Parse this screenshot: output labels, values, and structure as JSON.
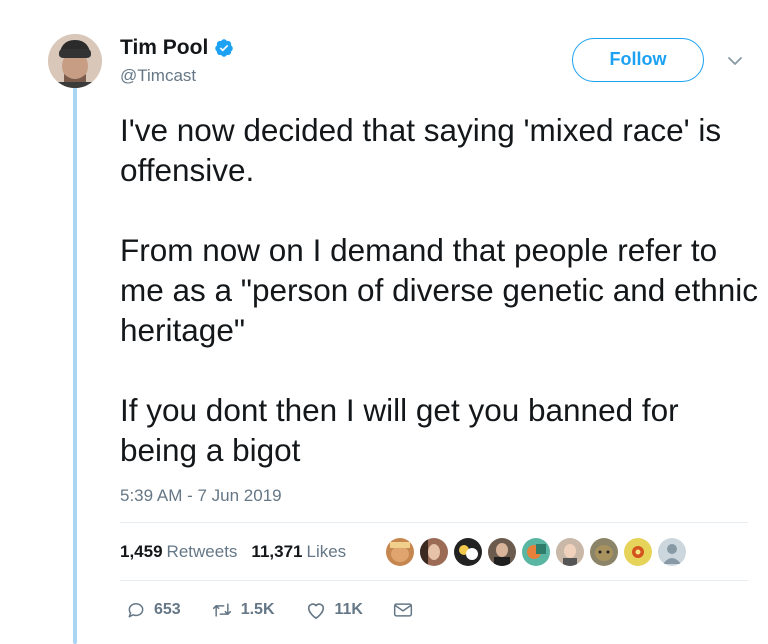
{
  "user": {
    "name": "Tim Pool",
    "handle": "@Timcast"
  },
  "follow_button": {
    "label": "Follow"
  },
  "tweet": {
    "paragraphs": [
      "I've now decided that saying 'mixed race' is offensive.",
      "From now on I demand that people refer to me as a \"person of diverse genetic and ethnic heritage\"",
      "If you dont then I will get you banned for being a bigot"
    ],
    "timestamp": "5:39 AM - 7 Jun 2019"
  },
  "stats": {
    "retweets_count": "1,459",
    "retweets_label": "Retweets",
    "likes_count": "11,371",
    "likes_label": "Likes"
  },
  "actions": {
    "reply_count": "653",
    "retweet_count": "1.5K",
    "like_count": "11K"
  },
  "colors": {
    "accent": "#1da1f2",
    "thread_line": "#a9d4f2",
    "muted_text": "#657786"
  }
}
